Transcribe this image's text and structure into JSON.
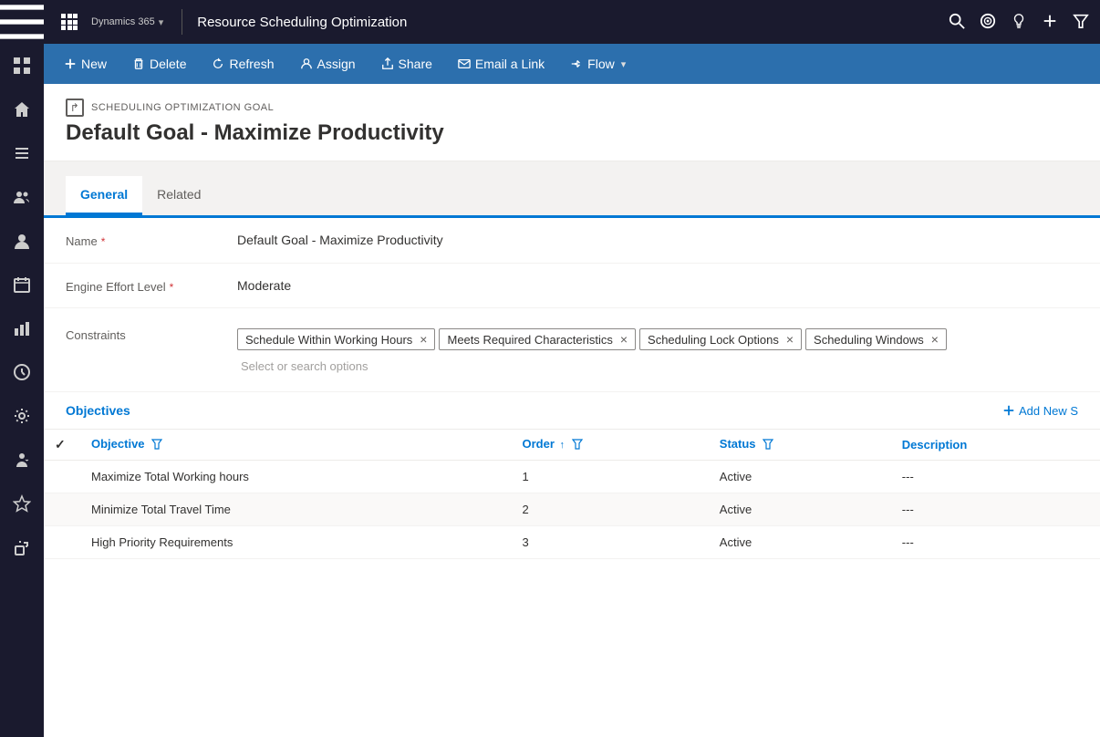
{
  "topBar": {
    "appTitle": "Dynamics 365",
    "chevron": "▾",
    "pageTitle": "Resource Scheduling Optimization",
    "icons": [
      "search",
      "target",
      "lightbulb",
      "plus",
      "filter"
    ]
  },
  "commandBar": {
    "buttons": [
      {
        "id": "new",
        "icon": "plus",
        "label": "New"
      },
      {
        "id": "delete",
        "icon": "trash",
        "label": "Delete"
      },
      {
        "id": "refresh",
        "icon": "refresh",
        "label": "Refresh"
      },
      {
        "id": "assign",
        "icon": "person",
        "label": "Assign"
      },
      {
        "id": "share",
        "icon": "share",
        "label": "Share"
      },
      {
        "id": "email",
        "icon": "email",
        "label": "Email a Link"
      },
      {
        "id": "flow",
        "icon": "flow",
        "label": "Flow",
        "hasChevron": true
      }
    ]
  },
  "record": {
    "typeLabel": "SCHEDULING OPTIMIZATION GOAL",
    "name": "Default Goal - Maximize Productivity"
  },
  "tabs": [
    {
      "id": "general",
      "label": "General",
      "active": true
    },
    {
      "id": "related",
      "label": "Related",
      "active": false
    }
  ],
  "form": {
    "fields": [
      {
        "id": "name",
        "label": "Name",
        "required": true,
        "value": "Default Goal - Maximize Productivity"
      },
      {
        "id": "engineEffortLevel",
        "label": "Engine Effort Level",
        "required": true,
        "value": "Moderate"
      }
    ],
    "constraints": {
      "label": "Constraints",
      "tags": [
        "Schedule Within Working Hours",
        "Meets Required Characteristics",
        "Scheduling Lock Options",
        "Scheduling Windows"
      ],
      "placeholder": "Select or search options"
    }
  },
  "objectives": {
    "sectionTitle": "Objectives",
    "addNewLabel": "Add New S",
    "columns": [
      {
        "id": "objective",
        "label": "Objective"
      },
      {
        "id": "order",
        "label": "Order",
        "sortAsc": true
      },
      {
        "id": "status",
        "label": "Status"
      },
      {
        "id": "description",
        "label": "Description"
      }
    ],
    "rows": [
      {
        "objective": "Maximize Total Working hours",
        "order": "1",
        "status": "Active",
        "description": "---"
      },
      {
        "objective": "Minimize Total Travel Time",
        "order": "2",
        "status": "Active",
        "description": "---"
      },
      {
        "objective": "High Priority Requirements",
        "order": "3",
        "status": "Active",
        "description": "---"
      }
    ]
  },
  "sidebar": {
    "icons": [
      "grid",
      "home",
      "list",
      "people-group",
      "person",
      "calendar",
      "chart-bar",
      "clock",
      "gear",
      "person-admin",
      "star",
      "plugin"
    ]
  }
}
